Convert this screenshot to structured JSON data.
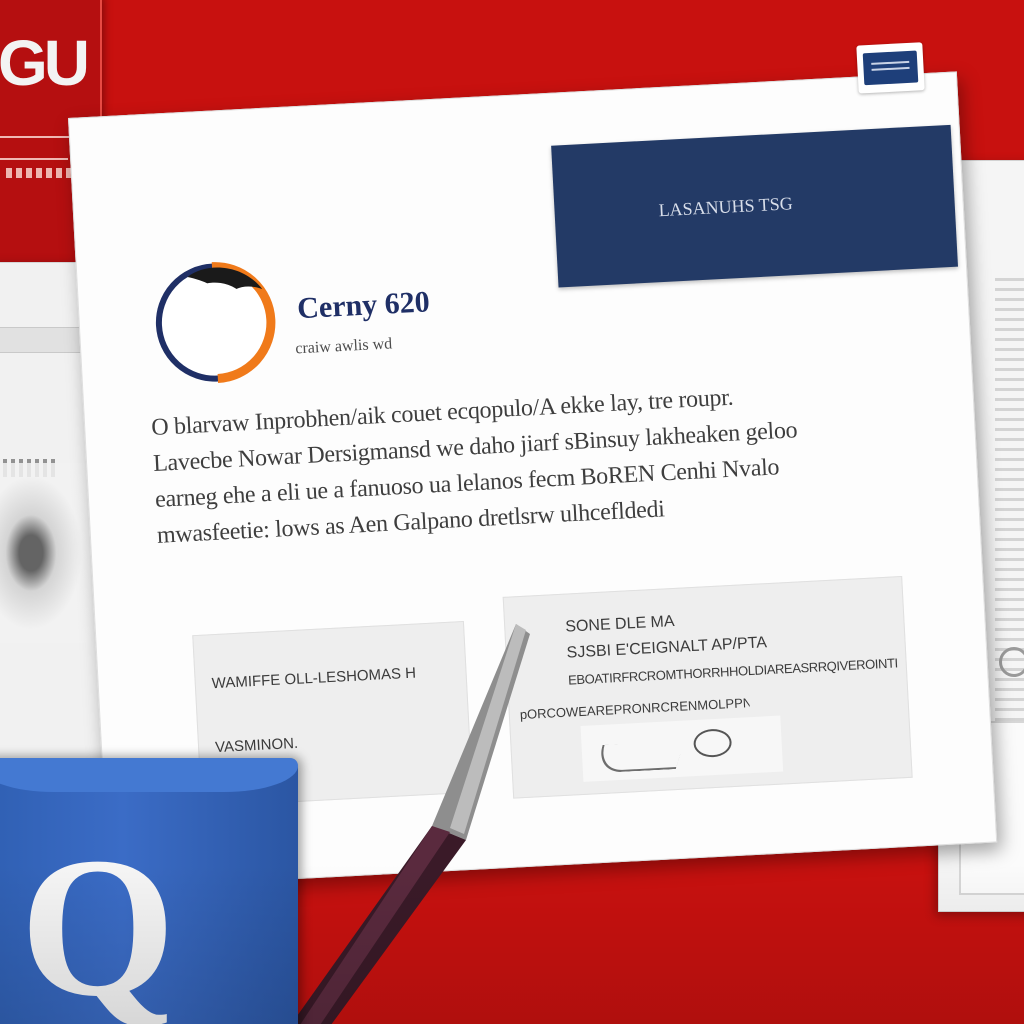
{
  "scene": {
    "description_colors": {
      "background": "#c8110f",
      "document": "#fdfdfd",
      "banner": "#233a66",
      "mug": "#3b6cc6",
      "emblem_blue": "#1f2f66",
      "emblem_orange": "#f07a1a"
    }
  },
  "logo_card": {
    "mark": "GU"
  },
  "document": {
    "banner_text": "LASANUHS TSG",
    "emblem_title": "Cerny 620",
    "emblem_subtitle": "craiw awlis wd",
    "body_lines": [
      "O blarvaw Inprobhen/aik couet ecqopulo/A ekke lay, tre roupr.",
      "Lavecbe Nowar Dersigmansd we daho jiarf sBinsuy lakheaken geloo",
      "earneg ehe a eli ue a fanuoso ua lelanos fecm BoREN Cenhi Nvalo",
      "mwasfeetie: lows as Aen Galpano dretlsrw ulhcefldedi"
    ],
    "field_left": {
      "line1": "WAMIFFE OLL-LESHOMAS H",
      "line2": "VASMINON."
    },
    "field_right": {
      "line1": "SONE DLE MA",
      "line2": "SJSBI E'CEIGNALT AP/PTA",
      "line3": "EBOATIRFRCROMTHORRHHOLDIAREASRRQIVEROINTINOLETRDIN",
      "line4": "pORCOWEAREPRONRCRENMOLPPNCES"
    }
  },
  "mug": {
    "letter": "Q"
  }
}
